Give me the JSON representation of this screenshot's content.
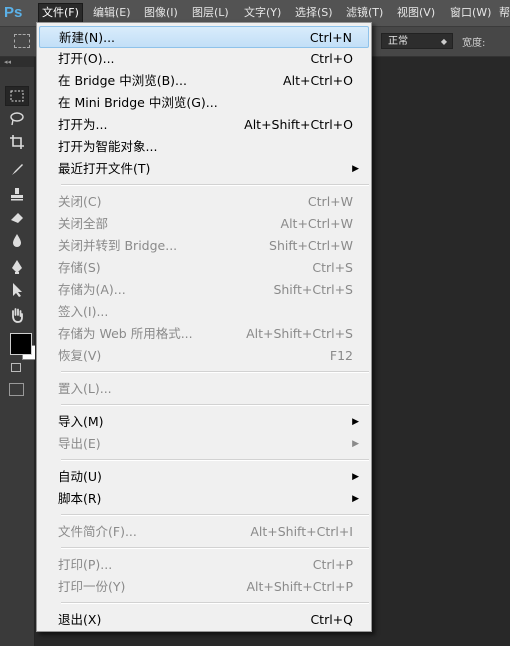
{
  "app": {
    "logo": "Ps"
  },
  "menubar": {
    "items": [
      "文件(F)",
      "编辑(E)",
      "图像(I)",
      "图层(L)",
      "文字(Y)",
      "选择(S)",
      "滤镜(T)",
      "视图(V)",
      "窗口(W)",
      "帮"
    ]
  },
  "options": {
    "mode_value": "正常",
    "width_label": "宽度:"
  },
  "tools": {
    "collapse_label": "◂◂",
    "icons": [
      "marquee-icon",
      "lasso-icon",
      "crop-icon",
      "brush-icon",
      "stamp-icon",
      "eraser-icon",
      "blur-icon",
      "pen-icon",
      "path-select-icon",
      "hand-icon"
    ],
    "foreground_color": "#000000",
    "background_color": "#ffffff"
  },
  "file_menu": {
    "items": [
      {
        "label": "新建(N)...",
        "shortcut": "Ctrl+N",
        "highlighted": true
      },
      {
        "label": "打开(O)...",
        "shortcut": "Ctrl+O"
      },
      {
        "label": "在 Bridge 中浏览(B)...",
        "shortcut": "Alt+Ctrl+O"
      },
      {
        "label": "在 Mini Bridge 中浏览(G)...",
        "shortcut": ""
      },
      {
        "label": "打开为...",
        "shortcut": "Alt+Shift+Ctrl+O"
      },
      {
        "label": "打开为智能对象...",
        "shortcut": ""
      },
      {
        "label": "最近打开文件(T)",
        "shortcut": "",
        "submenu": true
      },
      {
        "separator": true
      },
      {
        "label": "关闭(C)",
        "shortcut": "Ctrl+W",
        "disabled": true
      },
      {
        "label": "关闭全部",
        "shortcut": "Alt+Ctrl+W",
        "disabled": true
      },
      {
        "label": "关闭并转到 Bridge...",
        "shortcut": "Shift+Ctrl+W",
        "disabled": true
      },
      {
        "label": "存储(S)",
        "shortcut": "Ctrl+S",
        "disabled": true
      },
      {
        "label": "存储为(A)...",
        "shortcut": "Shift+Ctrl+S",
        "disabled": true
      },
      {
        "label": "签入(I)...",
        "shortcut": "",
        "disabled": true
      },
      {
        "label": "存储为 Web 所用格式...",
        "shortcut": "Alt+Shift+Ctrl+S",
        "disabled": true
      },
      {
        "label": "恢复(V)",
        "shortcut": "F12",
        "disabled": true
      },
      {
        "separator": true
      },
      {
        "label": "置入(L)...",
        "shortcut": "",
        "disabled": true
      },
      {
        "separator": true
      },
      {
        "label": "导入(M)",
        "shortcut": "",
        "submenu": true
      },
      {
        "label": "导出(E)",
        "shortcut": "",
        "submenu": true,
        "disabled": true
      },
      {
        "separator": true
      },
      {
        "label": "自动(U)",
        "shortcut": "",
        "submenu": true
      },
      {
        "label": "脚本(R)",
        "shortcut": "",
        "submenu": true
      },
      {
        "separator": true
      },
      {
        "label": "文件简介(F)...",
        "shortcut": "Alt+Shift+Ctrl+I",
        "disabled": true
      },
      {
        "separator": true
      },
      {
        "label": "打印(P)...",
        "shortcut": "Ctrl+P",
        "disabled": true
      },
      {
        "label": "打印一份(Y)",
        "shortcut": "Alt+Shift+Ctrl+P",
        "disabled": true
      },
      {
        "separator": true
      },
      {
        "label": "退出(X)",
        "shortcut": "Ctrl+Q"
      }
    ]
  }
}
